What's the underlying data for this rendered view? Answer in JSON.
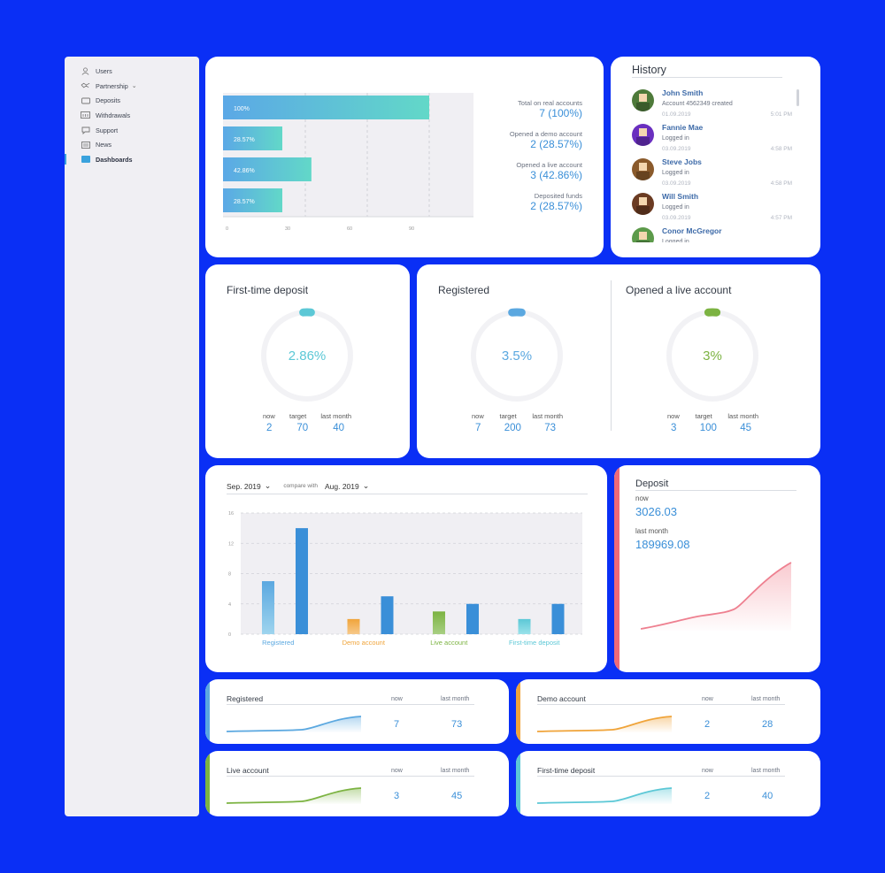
{
  "sidebar": {
    "items": [
      {
        "label": "Users",
        "icon": "user-icon"
      },
      {
        "label": "Partnership",
        "icon": "handshake-icon"
      },
      {
        "label": "Deposits",
        "icon": "wallet-icon"
      },
      {
        "label": "Withdrawals",
        "icon": "withdraw-icon"
      },
      {
        "label": "Support",
        "icon": "chat-icon"
      },
      {
        "label": "News",
        "icon": "news-icon"
      },
      {
        "label": "Dashboards",
        "icon": "dashboard-icon"
      }
    ]
  },
  "funnel": {
    "rows": [
      {
        "bar_label": "100%",
        "label": "Total on real accounts",
        "value": "7 (100%)"
      },
      {
        "bar_label": "28.57%",
        "label": "Opened a demo account",
        "value": "2 (28.57%)"
      },
      {
        "bar_label": "42.86%",
        "label": "Opened a live account",
        "value": "3 (42.86%)"
      },
      {
        "bar_label": "28.57%",
        "label": "Deposited funds",
        "value": "2 (28.57%)"
      }
    ],
    "ticks": [
      "0",
      "30",
      "60",
      "90"
    ]
  },
  "history": {
    "title": "History",
    "entries": [
      {
        "name": "John Smith",
        "action": "Account 4562349 created",
        "date": "01.09.2019",
        "time": "5:01 PM",
        "avatar": "avatar-green"
      },
      {
        "name": "Fannie Mae",
        "action": "Logged in",
        "date": "03.09.2019",
        "time": "4:58 PM",
        "avatar": "avatar-purple"
      },
      {
        "name": "Steve Jobs",
        "action": "Logged in",
        "date": "03.09.2019",
        "time": "4:58 PM",
        "avatar": "avatar-brown"
      },
      {
        "name": "Will Smith",
        "action": "Logged in",
        "date": "03.09.2019",
        "time": "4:57 PM",
        "avatar": "avatar-darkbrown"
      },
      {
        "name": "Conor McGregor",
        "action": "Logged in",
        "date": "",
        "time": "",
        "avatar": "avatar-lightgreen"
      }
    ]
  },
  "gauges": [
    {
      "title": "First-time deposit",
      "center": "2.86%",
      "fraction": 0.0286,
      "now_label": "now",
      "target_label": "target",
      "last_label": "last month",
      "now": "2",
      "target": "70",
      "last": "40",
      "color": "#5cc8d6"
    },
    {
      "title": "Registered",
      "center": "3.5%",
      "fraction": 0.035,
      "now_label": "now",
      "target_label": "target",
      "last_label": "last month",
      "now": "7",
      "target": "200",
      "last": "73",
      "color": "#5ba8e0"
    },
    {
      "title": "Opened a live account",
      "center": "3%",
      "fraction": 0.03,
      "now_label": "now",
      "target_label": "target",
      "last_label": "last month",
      "now": "3",
      "target": "100",
      "last": "45",
      "color": "#7cb342"
    }
  ],
  "compare": {
    "period": "Sep. 2019",
    "compare_label": "compare with",
    "compare_period": "Aug. 2019"
  },
  "chart_data": {
    "type": "bar",
    "categories": [
      "Registered",
      "Demo account",
      "Live account",
      "First-time deposit"
    ],
    "category_colors": [
      "#5ba8e0",
      "#f0a43a",
      "#7cb342",
      "#5cc8d6"
    ],
    "series": [
      {
        "values": [
          7,
          2,
          3,
          2
        ]
      },
      {
        "values": [
          14,
          5,
          4,
          4
        ]
      }
    ],
    "ylim": [
      0,
      16
    ],
    "yticks": [
      "0",
      "4",
      "8",
      "12",
      "16"
    ],
    "grid": true
  },
  "deposit": {
    "title": "Deposit",
    "now_label": "now",
    "now_value": "3026.03",
    "last_label": "last month",
    "last_value": "189969.08"
  },
  "mini_cards": [
    {
      "title": "Registered",
      "now_label": "now",
      "last_label": "last month",
      "now": "7",
      "last": "73",
      "color": "#5ba8e0"
    },
    {
      "title": "Demo account",
      "now_label": "now",
      "last_label": "last month",
      "now": "2",
      "last": "28",
      "color": "#f0a43a"
    },
    {
      "title": "Live account",
      "now_label": "now",
      "last_label": "last month",
      "now": "3",
      "last": "45",
      "color": "#7cb342"
    },
    {
      "title": "First-time deposit",
      "now_label": "now",
      "last_label": "last month",
      "now": "2",
      "last": "40",
      "color": "#5cc8d6"
    }
  ]
}
